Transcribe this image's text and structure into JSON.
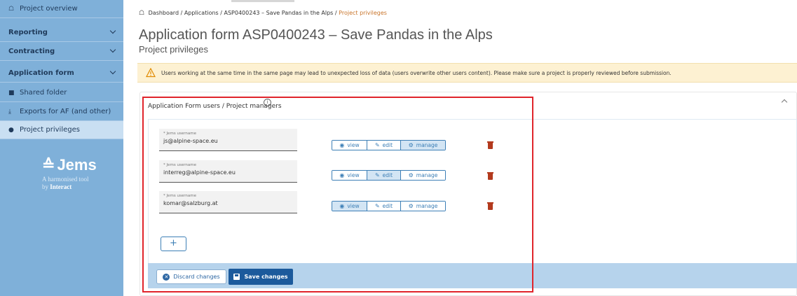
{
  "sidebar": {
    "items": [
      {
        "label": "Project overview",
        "icon": "home-icon"
      },
      {
        "label": "Reporting",
        "expandable": true
      },
      {
        "label": "Contracting",
        "expandable": true
      },
      {
        "label": "Application form",
        "expandable": true
      },
      {
        "label": "Shared folder",
        "icon": "folder-icon"
      },
      {
        "label": "Exports for AF (and other)",
        "icon": "download-icon"
      },
      {
        "label": "Project privileges",
        "icon": "users-key-icon",
        "active": true
      }
    ],
    "logo": {
      "name": "Jems",
      "tagline_1": "A harmonised tool",
      "tagline_by": "by ",
      "tagline_brand": "Interact"
    }
  },
  "breadcrumb": {
    "items": [
      "Dashboard",
      "Applications",
      "ASP0400243 – Save Pandas in the Alps"
    ],
    "separator": "/",
    "current": "Project privileges"
  },
  "page": {
    "title": "Application form ASP0400243 – Save Pandas in the Alps",
    "subtitle": "Project privileges"
  },
  "warning": {
    "text": "Users working at the same time in the same page may lead to unexpected loss of data (users overwrite other users content). Please make sure a project is properly reviewed before submission."
  },
  "card": {
    "title": "Application Form users / Project managers",
    "users": [
      {
        "label": "* Jems username",
        "value": "js@alpine-space.eu",
        "permission": "manage"
      },
      {
        "label": "* Jems username",
        "value": "interreg@alpine-space.eu",
        "permission": "edit"
      },
      {
        "label": "* Jems username",
        "value": "komar@salzburg.at",
        "permission": "view"
      }
    ],
    "permission_labels": {
      "view": "view",
      "edit": "edit",
      "manage": "manage"
    },
    "add_label": "+",
    "discard_label": "Discard changes",
    "save_label": "Save changes"
  },
  "colors": {
    "sidebar": "#7fb0d9",
    "accent": "#1c5a9c",
    "highlight": "#e0242b",
    "breadcrumb_current": "#c9752b"
  }
}
